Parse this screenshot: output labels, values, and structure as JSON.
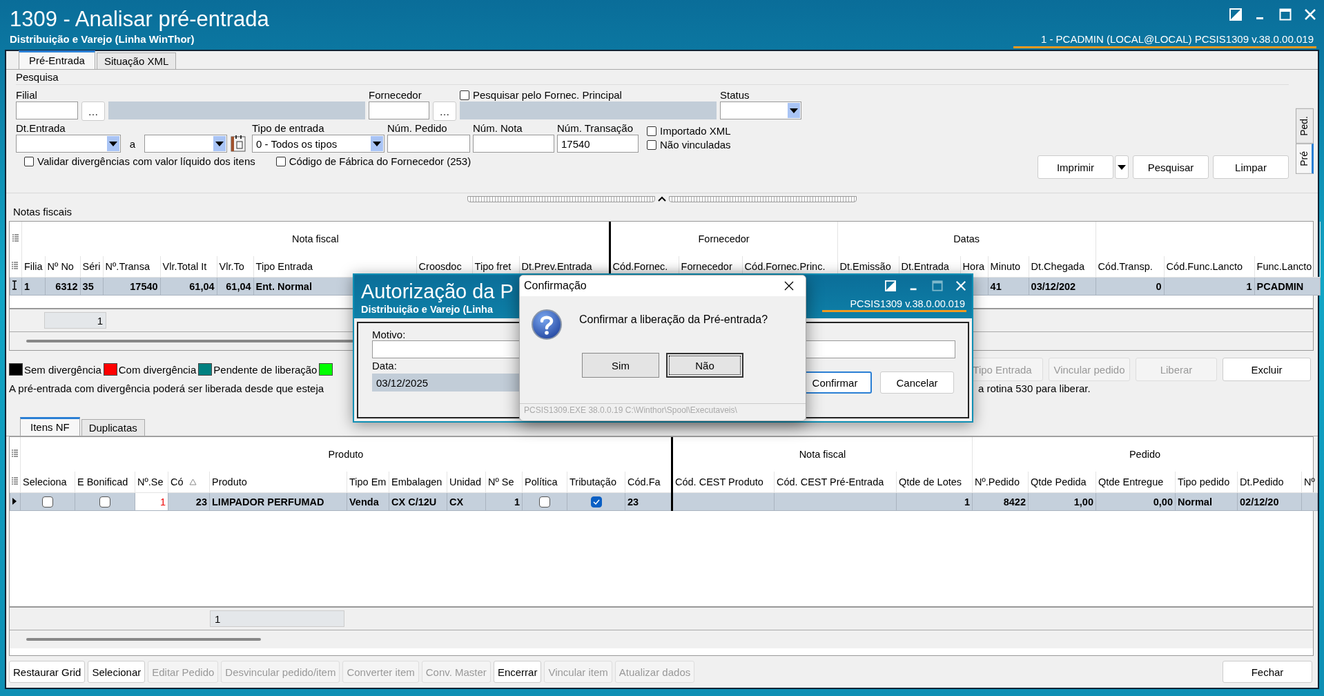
{
  "window": {
    "title": "1309 - Analisar pré-entrada",
    "subtitle": "Distribuição e Varejo (Linha WinThor)",
    "user_info": "1 - PCADMIN (LOCAL@LOCAL)   PCSIS1309  v.38.0.00.019"
  },
  "main_tabs": [
    {
      "label": "Pré-Entrada",
      "selected": true
    },
    {
      "label": "Situação XML",
      "selected": false
    }
  ],
  "search": {
    "group": "Pesquisa",
    "filial_label": "Filial",
    "fornecedor_label": "Fornecedor",
    "ellipsis": "…",
    "fornec_principal": {
      "label": "Pesquisar pelo Fornec. Principal",
      "checked": false
    },
    "status_label": "Status",
    "dt_entrada_label": "Dt.Entrada",
    "date_separator": "a",
    "tipo_entrada": {
      "label": "Tipo de entrada",
      "value": "0 - Todos os tipos"
    },
    "num_pedido_label": "Núm. Pedido",
    "num_nota_label": "Núm. Nota",
    "num_transacao": {
      "label": "Núm. Transação",
      "value": "17540"
    },
    "side_checks": [
      {
        "label": "Importado XML",
        "checked": false
      },
      {
        "label": "Não vinculadas",
        "checked": false
      }
    ],
    "bottom_checks": [
      {
        "label": "Validar divergências com valor líquido dos itens",
        "checked": false
      },
      {
        "label": "Código de Fábrica do Fornecedor (253)",
        "checked": false
      }
    ]
  },
  "actions": [
    {
      "label": "Imprimir",
      "dropdown": true
    },
    {
      "label": "Pesquisar",
      "dropdown": false
    },
    {
      "label": "Limpar",
      "dropdown": false
    }
  ],
  "side_tabs": [
    {
      "label": "Ped.",
      "selected": false
    },
    {
      "label": "Pré",
      "selected": true
    }
  ],
  "notas": {
    "title": "Notas fiscais",
    "groups": [
      "Nota fiscal",
      "Fornecedor",
      "Datas"
    ],
    "columns": [
      "Filia",
      "Nº No",
      "Séri",
      "Nº.Transa",
      "Vlr.Total It",
      "Vlr.To",
      "Tipo Entrada",
      "Croosdoc",
      "Tipo fret",
      "Dt.Prev.Entrada",
      "Cód.Fornec.",
      "Fornecedor",
      "Cód.Fornec.Princ.",
      "Dt.Emissão",
      "Dt.Entrada",
      "Hora",
      "Minuto",
      "Dt.Chegada",
      "Cód.Transp.",
      "Cód.Func.Lancto",
      "Func.Lancto"
    ],
    "rows": [
      {
        "selected": true,
        "cells": [
          "1",
          "6312",
          "35",
          "17540",
          "61,04",
          "61,04",
          "Ent. Normal",
          null,
          null,
          null,
          null,
          null,
          null,
          null,
          null,
          null,
          "41",
          "03/12/202",
          "0",
          "1",
          "PCADMIN"
        ]
      }
    ],
    "footer_value": "1"
  },
  "legend": [
    {
      "label": "Sem divergência",
      "color": "#000000"
    },
    {
      "label": "Com divergência",
      "color": "#ff0000"
    },
    {
      "label": "Pendente de liberação",
      "color": "#008080"
    },
    {
      "color": "#00ff00"
    }
  ],
  "notice_parts": [
    "A pré-entrada com divergência poderá ser liberada desde que esteja",
    "a rotina 530 para liberar."
  ],
  "nota_buttons": [
    {
      "label": "Tipo Entrada",
      "disabled": true
    },
    {
      "label": "Vincular pedido",
      "disabled": true
    },
    {
      "label": "Liberar",
      "disabled": true
    },
    {
      "label": "Excluir",
      "disabled": false
    }
  ],
  "items_tabs": [
    {
      "label": "Itens NF",
      "selected": true
    },
    {
      "label": "Duplicatas",
      "selected": false
    }
  ],
  "items": {
    "groups": [
      "Produto",
      "Nota fiscal",
      "Pedido"
    ],
    "columns": [
      {
        "label": "Seleciona",
        "sorted": false
      },
      {
        "label": "E Bonificad",
        "sorted": false
      },
      {
        "label": "Nº.Se",
        "sorted": false
      },
      {
        "label": "Có",
        "sorted": true
      },
      {
        "label": "Produto",
        "sorted": false
      },
      {
        "label": "Tipo Em",
        "sorted": false
      },
      {
        "label": "Embalagen",
        "sorted": false
      },
      {
        "label": "Unidad",
        "sorted": false
      },
      {
        "label": "Nº Se",
        "sorted": false
      },
      {
        "label": "Política",
        "sorted": false
      },
      {
        "label": "Tributação",
        "sorted": false
      },
      {
        "label": "Cód.Fa",
        "sorted": false
      },
      {
        "label": "Cód. CEST Produto",
        "sorted": false
      },
      {
        "label": "Cód. CEST Pré-Entrada",
        "sorted": false
      },
      {
        "label": "Qtde de Lotes",
        "sorted": false
      },
      {
        "label": "Nº.Pedido",
        "sorted": false
      },
      {
        "label": "Qtde Pedida",
        "sorted": false
      },
      {
        "label": "Qtde Entregue",
        "sorted": false
      },
      {
        "label": "Tipo pedido",
        "sorted": false
      },
      {
        "label": "Dt.Pedido",
        "sorted": false
      },
      {
        "label": "Nº",
        "sorted": false
      }
    ],
    "rows": [
      {
        "selected": true,
        "cells": [
          {
            "kind": "check",
            "checked": false
          },
          {
            "kind": "check",
            "checked": false
          },
          {
            "kind": "alert",
            "text": "1"
          },
          {
            "kind": "text",
            "text": "23"
          },
          {
            "kind": "text",
            "text": "LIMPADOR PERFUMAD"
          },
          {
            "kind": "text",
            "text": "Venda"
          },
          {
            "kind": "text",
            "text": "CX C/12U"
          },
          {
            "kind": "text",
            "text": "CX"
          },
          {
            "kind": "text",
            "text": "1"
          },
          {
            "kind": "check",
            "checked": false
          },
          {
            "kind": "check",
            "checked": true
          },
          {
            "kind": "text",
            "text": "23"
          },
          null,
          null,
          {
            "kind": "text",
            "text": "1"
          },
          {
            "kind": "text",
            "text": "8422"
          },
          {
            "kind": "text",
            "text": "1,00"
          },
          {
            "kind": "text",
            "text": "0,00"
          },
          {
            "kind": "text",
            "text": "Normal"
          },
          {
            "kind": "text",
            "text": "02/12/20"
          },
          null
        ]
      }
    ],
    "footer_value": "1"
  },
  "bottom_buttons": [
    {
      "label": "Restaurar Grid",
      "disabled": false
    },
    {
      "label": "Selecionar",
      "disabled": false
    },
    {
      "label": "Editar Pedido",
      "disabled": true
    },
    {
      "label": "Desvincular pedido/item",
      "disabled": true
    },
    {
      "label": "Converter item",
      "disabled": true
    },
    {
      "label": "Conv. Master",
      "disabled": true
    },
    {
      "label": "Encerrar",
      "disabled": false
    },
    {
      "label": "Vincular item",
      "disabled": true
    },
    {
      "label": "Atualizar dados",
      "disabled": true
    }
  ],
  "close_button": "Fechar",
  "auth_dialog": {
    "title": "Autorização da P",
    "subtitle": "Distribuição e Varejo (Linha",
    "version": "PCSIS1309  v.38.0.00.019",
    "motivo_label": "Motivo:",
    "data_label": "Data:",
    "data_value": "03/12/2025",
    "buttons": [
      {
        "label": "Confirmar",
        "selected": true
      },
      {
        "label": "Cancelar",
        "selected": false
      }
    ]
  },
  "confirm_dialog": {
    "title": "Confirmação",
    "message": "Confirmar a liberação da Pré-entrada?",
    "buttons": [
      {
        "label": "Sim",
        "selected": false
      },
      {
        "label": "Não",
        "selected": true
      }
    ],
    "footer": "PCSIS1309.EXE 38.0.0.19 C:\\Winthor\\Spool\\Executaveis\\"
  }
}
